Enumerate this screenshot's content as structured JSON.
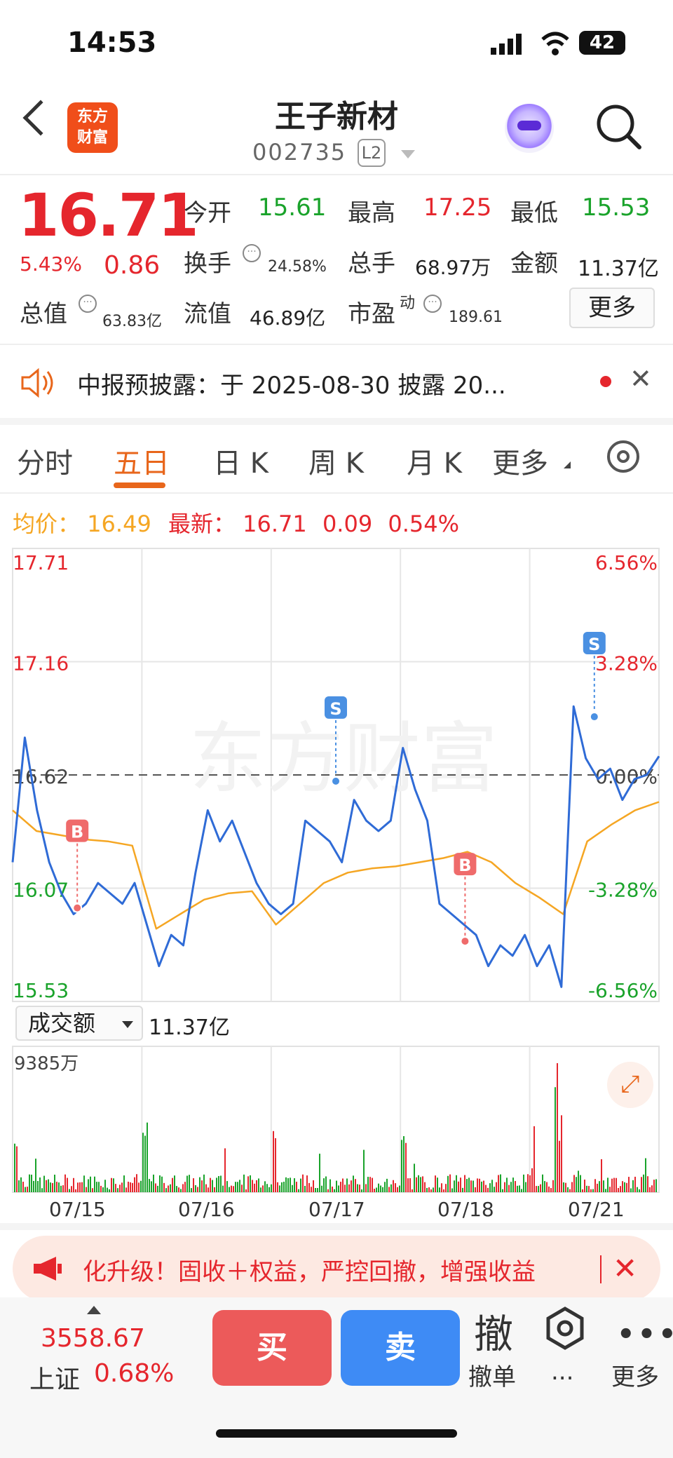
{
  "status_bar": {
    "time": "14:53",
    "battery": "42"
  },
  "header": {
    "brand_line1": "东方",
    "brand_line2": "财富",
    "title": "王子新材",
    "code": "002735",
    "level": "L2"
  },
  "quote": {
    "price": "16.71",
    "change_pct": "5.43%",
    "change": "0.86",
    "open_label": "今开",
    "open": "15.61",
    "high_label": "最高",
    "high": "17.25",
    "low_label": "最低",
    "low": "15.53",
    "turnover_label": "换手",
    "turnover": "24.58%",
    "volume_label": "总手",
    "volume": "68.97万",
    "amount_label": "金额",
    "amount": "11.37亿",
    "mktcap_label": "总值",
    "mktcap": "63.83亿",
    "float_label": "流值",
    "float": "46.89亿",
    "pe_label": "市盈",
    "pe_sup": "动",
    "pe": "189.61",
    "more_label": "更多"
  },
  "notice": {
    "text": "中报预披露：于 2025-08-30 披露 20...",
    "close": "✕"
  },
  "tabs": [
    {
      "label": "分时"
    },
    {
      "label": "五日"
    },
    {
      "label": "日 K"
    },
    {
      "label": "周 K"
    },
    {
      "label": "月 K"
    },
    {
      "label": "更多"
    }
  ],
  "avg_row": {
    "avg_label": "均价：",
    "avg": "16.49",
    "latest_label": "最新：",
    "latest": "16.71",
    "latest_chg": "0.09",
    "latest_pct": "0.54%"
  },
  "chart_data": {
    "type": "line",
    "title": "",
    "x_dates": [
      "07/15",
      "07/16",
      "07/17",
      "07/18",
      "07/21"
    ],
    "y_ticks_left": [
      "17.71",
      "17.16",
      "16.62",
      "16.07",
      "15.53"
    ],
    "y_ticks_right": [
      "6.56%",
      "3.28%",
      "0.00%",
      "-3.28%",
      "-6.56%"
    ],
    "prev_close": 16.62,
    "ylim": [
      15.53,
      17.71
    ],
    "series": [
      {
        "values": [
          16.2,
          16.8,
          16.45,
          16.2,
          16.05,
          15.95,
          16.0,
          16.1,
          16.05,
          16.0,
          16.1,
          15.9,
          15.7,
          15.85,
          15.8,
          16.15,
          16.45,
          16.3,
          16.4,
          16.25,
          16.1,
          16.0,
          15.95,
          16.0,
          16.4,
          16.35,
          16.3,
          16.2,
          16.5,
          16.4,
          16.35,
          16.4,
          16.75,
          16.55,
          16.4,
          16.0,
          15.95,
          15.9,
          15.85,
          15.7,
          15.8,
          15.75,
          15.85,
          15.7,
          15.8,
          15.6,
          16.95,
          16.7,
          16.6,
          16.65,
          16.5,
          16.6,
          16.62,
          16.71
        ]
      },
      {
        "values": [
          16.45,
          16.35,
          16.33,
          16.31,
          16.3,
          16.28,
          15.88,
          15.95,
          16.02,
          16.05,
          16.06,
          15.9,
          16.0,
          16.1,
          16.15,
          16.17,
          16.18,
          16.2,
          16.22,
          16.25,
          16.2,
          16.1,
          16.03,
          15.95,
          16.3,
          16.38,
          16.45,
          16.49
        ]
      }
    ],
    "markers": [
      {
        "label": "B",
        "type": "buy",
        "day": "07/15",
        "price": 15.98
      },
      {
        "label": "S",
        "type": "sell",
        "day": "07/17",
        "price": 16.59
      },
      {
        "label": "B",
        "type": "buy",
        "day": "07/18",
        "price": 15.82
      },
      {
        "label": "S",
        "type": "sell",
        "day": "07/21",
        "price": 16.9
      }
    ],
    "volume_max": "9385万",
    "volume_total": "11.37亿"
  },
  "volume": {
    "selector_label": "成交额",
    "total": "11.37亿",
    "max_label": "9385万"
  },
  "watermark": "东方财富",
  "ad": {
    "text": "化升级！固收＋权益，严控回撤，增强收益",
    "close": "✕"
  },
  "bottom": {
    "index_value": "3558.67",
    "index_name": "上证",
    "index_pct": "0.68%",
    "buy": "买",
    "sell": "卖",
    "cancel_icon": "撤",
    "cancel_label": "撤单",
    "hex_label": "...",
    "more_label": "更多"
  },
  "colors": {
    "up": "#e5262d",
    "down": "#1aa32b",
    "price_line": "#2f6bd6",
    "avg_line": "#f5a623",
    "accent": "#e8661b"
  }
}
